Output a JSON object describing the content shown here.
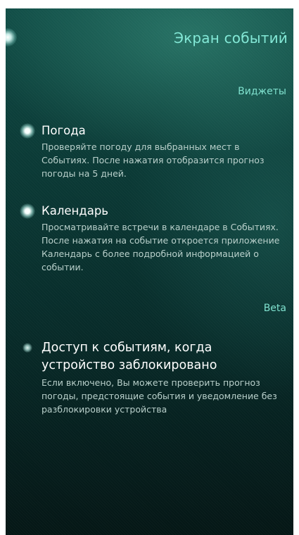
{
  "header": {
    "title": "Экран событий"
  },
  "sections": {
    "widgets_label": "Виджеты",
    "beta_label": "Beta"
  },
  "widgets": [
    {
      "title": "Погода",
      "description": "Проверяйте погоду для выбранных мест в Событиях. После нажатия отобразится прогноз погоды на 5 дней.",
      "enabled": true
    },
    {
      "title": "Календарь",
      "description": "Просматривайте встречи в календаре в Событиях. После нажатия на событие откроется приложение Календарь с более подробной информацией о событии.",
      "enabled": true
    }
  ],
  "beta": {
    "title": "Доступ к событиям, когда устройство заблокировано",
    "description": "Если включено, Вы можете проверить прогноз погоды, предстоящие события и уведомление без разблокировки устройства",
    "enabled": false
  }
}
